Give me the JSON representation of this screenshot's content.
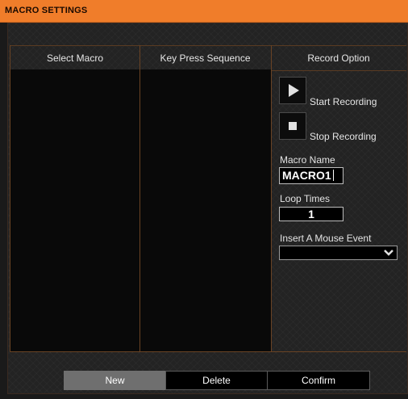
{
  "window": {
    "title": "MACRO SETTINGS"
  },
  "columns": {
    "select_macro": "Select Macro",
    "key_press_sequence": "Key Press Sequence",
    "record_option": "Record Option"
  },
  "record": {
    "start_label": "Start Recording",
    "stop_label": "Stop Recording",
    "macro_name_label": "Macro Name",
    "macro_name_value": "MACRO1",
    "loop_times_label": "Loop Times",
    "loop_times_value": "1",
    "mouse_event_label": "Insert A Mouse Event",
    "mouse_event_value": ""
  },
  "buttons": {
    "new": "New",
    "delete": "Delete",
    "confirm": "Confirm"
  },
  "colors": {
    "accent": "#f07d2a",
    "divider": "#6a4324",
    "active_button": "#6f6f6f"
  },
  "icons": {
    "start": "play-icon",
    "stop": "stop-icon",
    "dropdown": "chevron-down-icon"
  }
}
